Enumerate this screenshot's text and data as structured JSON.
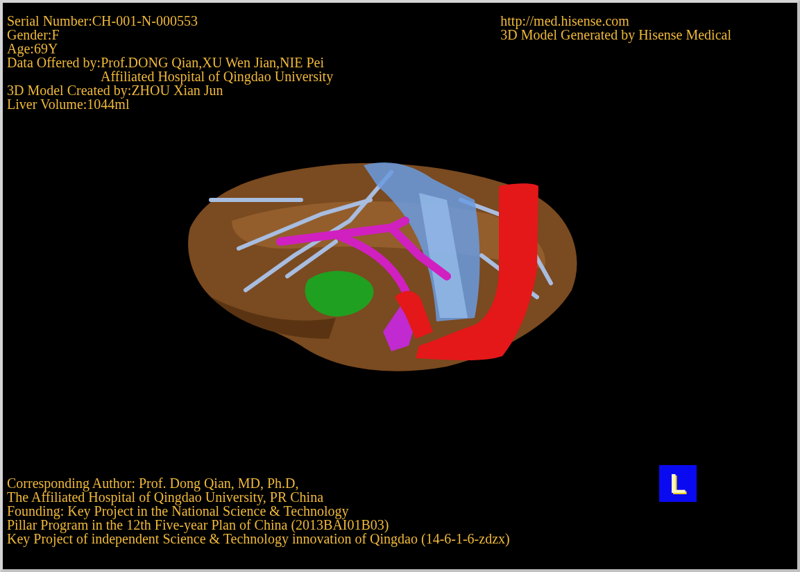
{
  "header_left": [
    {
      "text": "Serial Number:CH-001-N-000553",
      "indented": false
    },
    {
      "text": "Gender:F",
      "indented": false
    },
    {
      "text": "Age:69Y",
      "indented": false
    },
    {
      "text": "Data Offered by:Prof.DONG Qian,XU Wen Jian,NIE Pei",
      "indented": false
    },
    {
      "text": "Affiliated Hospital of Qingdao University",
      "indented": true
    },
    {
      "text": "3D Model Created by:ZHOU Xian Jun",
      "indented": false
    },
    {
      "text": "Liver Volume:1044ml",
      "indented": false
    }
  ],
  "header_right": [
    "http://med.hisense.com",
    "3D Model Generated by Hisense Medical"
  ],
  "footer": [
    "Corresponding Author: Prof. Dong Qian, MD, Ph.D,",
    "The Affiliated Hospital of Qingdao University, PR China",
    "Founding: Key Project in the National Science & Technology",
    "Pillar Program in the 12th Five-year Plan of China (2013BAI01B03)",
    "Key Project of independent Science & Technology innovation of Qingdao (14-6-1-6-zdzx)"
  ],
  "orientation_marker": "L"
}
